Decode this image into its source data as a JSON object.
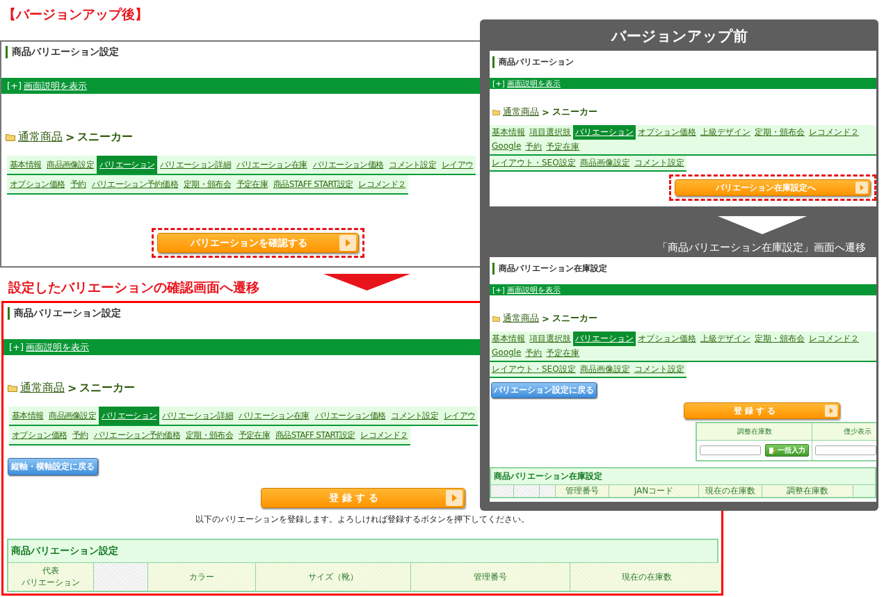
{
  "after_heading": "【バージョンアップ後】",
  "after_edit_screen": {
    "title": "商品バリエーション設定",
    "help": {
      "prefix": "[+]",
      "link": "画面説明を表示"
    },
    "breadcrumb": {
      "link": "通常商品",
      "separator": ">",
      "current": "スニーカー"
    },
    "tab_rows": [
      [
        {
          "label": "基本情報",
          "selected": false
        },
        {
          "label": "商品画像設定",
          "selected": false
        },
        {
          "label": "バリエーション",
          "selected": true
        },
        {
          "label": "バリエーション詳細",
          "selected": false
        },
        {
          "label": "バリエーション在庫",
          "selected": false
        },
        {
          "label": "バリエーション価格",
          "selected": false
        },
        {
          "label": "コメント設定",
          "selected": false
        },
        {
          "label": "レイアウ",
          "selected": false
        }
      ],
      [
        {
          "label": "オプション価格",
          "selected": false
        },
        {
          "label": "予約",
          "selected": false
        },
        {
          "label": "バリエーション予約価格",
          "selected": false
        },
        {
          "label": "定期・頒布会",
          "selected": false
        },
        {
          "label": "予定在庫",
          "selected": false
        },
        {
          "label": "商品STAFF START設定",
          "selected": false
        },
        {
          "label": "レコメンド２",
          "selected": false
        }
      ]
    ],
    "confirm_button": {
      "label": "バリエーションを確認する",
      "highlighted": true
    }
  },
  "after_caption": "設定したバリエーションの確認画面へ遷移",
  "after_confirm_screen": {
    "title": "商品バリエーション設定",
    "help": {
      "prefix": "[+]",
      "link": "画面説明を表示"
    },
    "breadcrumb": {
      "link": "通常商品",
      "separator": ">",
      "current": "スニーカー"
    },
    "tab_rows": [
      [
        {
          "label": "基本情報",
          "selected": false
        },
        {
          "label": "商品画像設定",
          "selected": false
        },
        {
          "label": "バリエーション",
          "selected": true
        },
        {
          "label": "バリエーション詳細",
          "selected": false
        },
        {
          "label": "バリエーション在庫",
          "selected": false
        },
        {
          "label": "バリエーション価格",
          "selected": false
        },
        {
          "label": "コメント設定",
          "selected": false
        },
        {
          "label": "レイアウ",
          "selected": false
        }
      ],
      [
        {
          "label": "オプション価格",
          "selected": false
        },
        {
          "label": "予約",
          "selected": false
        },
        {
          "label": "バリエーション予約価格",
          "selected": false
        },
        {
          "label": "定期・頒布会",
          "selected": false
        },
        {
          "label": "予定在庫",
          "selected": false
        },
        {
          "label": "商品STAFF START設定",
          "selected": false
        },
        {
          "label": "レコメンド２",
          "selected": false
        }
      ]
    ],
    "back_button": "縦軸・横軸設定に戻る",
    "register_button": {
      "label": "登 録 す る",
      "highlighted": false
    },
    "note": "以下のバリエーションを登録します。よろしければ登録するボタンを押下してください。",
    "table": {
      "title": "商品バリエーション設定",
      "columns": [
        {
          "kind": "stacked",
          "lines": [
            "代表",
            "バリエーション"
          ]
        },
        {
          "kind": "blank"
        },
        {
          "kind": "text",
          "label": "カラー"
        },
        {
          "kind": "text",
          "label": "サイズ（靴）"
        },
        {
          "kind": "text",
          "label": "管理番号"
        },
        {
          "kind": "text",
          "label": "現在の在庫数"
        }
      ]
    }
  },
  "before": {
    "heading": "バージョンアップ前",
    "edit_screen": {
      "title": "商品バリエーション",
      "help": {
        "prefix": "[+]",
        "link": "画面説明を表示"
      },
      "breadcrumb": {
        "link": "通常商品",
        "separator": ">",
        "current": "スニーカー"
      },
      "tab_rows": [
        [
          {
            "label": "基本情報",
            "selected": false
          },
          {
            "label": "項目選択肢",
            "selected": false
          },
          {
            "label": "バリエーション",
            "selected": true
          },
          {
            "label": "オプション価格",
            "selected": false
          },
          {
            "label": "上級デザイン",
            "selected": false
          },
          {
            "label": "定期・頒布会",
            "selected": false
          },
          {
            "label": "レコメンド２",
            "selected": false
          },
          {
            "label": "Google",
            "selected": false
          },
          {
            "label": "予約",
            "selected": false
          },
          {
            "label": "予定在庫",
            "selected": false
          }
        ],
        [
          {
            "label": "レイアウト・SEO設定",
            "selected": false
          },
          {
            "label": "商品画像設定",
            "selected": false
          },
          {
            "label": "コメント設定",
            "selected": false
          }
        ]
      ],
      "next_button": {
        "label": "バリエーション在庫設定へ",
        "highlighted": true
      }
    },
    "caption": "「商品バリエーション在庫設定」画面へ遷移",
    "stock_screen": {
      "title": "商品バリエーション在庫設定",
      "help": {
        "prefix": "[+]",
        "link": "画面説明を表示"
      },
      "breadcrumb": {
        "link": "通常商品",
        "separator": ">",
        "current": "スニーカー"
      },
      "tab_rows": [
        [
          {
            "label": "基本情報",
            "selected": false
          },
          {
            "label": "項目選択肢",
            "selected": false
          },
          {
            "label": "バリエーション",
            "selected": true
          },
          {
            "label": "オプション価格",
            "selected": false
          },
          {
            "label": "上級デザイン",
            "selected": false
          },
          {
            "label": "定期・頒布会",
            "selected": false
          },
          {
            "label": "レコメンド２",
            "selected": false
          },
          {
            "label": "Google",
            "selected": false
          },
          {
            "label": "予約",
            "selected": false
          },
          {
            "label": "予定在庫",
            "selected": false
          }
        ],
        [
          {
            "label": "レイアウト・SEO設定",
            "selected": false
          },
          {
            "label": "商品画像設定",
            "selected": false
          },
          {
            "label": "コメント設定",
            "selected": false
          }
        ]
      ],
      "back_button": "バリエーション設定に戻る",
      "register_button": {
        "label": "登 録 す る",
        "highlighted": false
      },
      "bulk_table": {
        "columns": [
          "調整在庫数",
          "僅少表示"
        ],
        "bulk_button": "一括入力"
      },
      "table": {
        "title": "商品バリエーション在庫設定",
        "columns": [
          {
            "kind": "blank"
          },
          {
            "kind": "blank"
          },
          {
            "kind": "blank"
          },
          {
            "kind": "text",
            "label": "管理番号"
          },
          {
            "kind": "text",
            "label": "JANコード"
          },
          {
            "kind": "text",
            "label": "現在の在庫数"
          },
          {
            "kind": "text",
            "label": "調整在庫数"
          }
        ]
      }
    }
  }
}
